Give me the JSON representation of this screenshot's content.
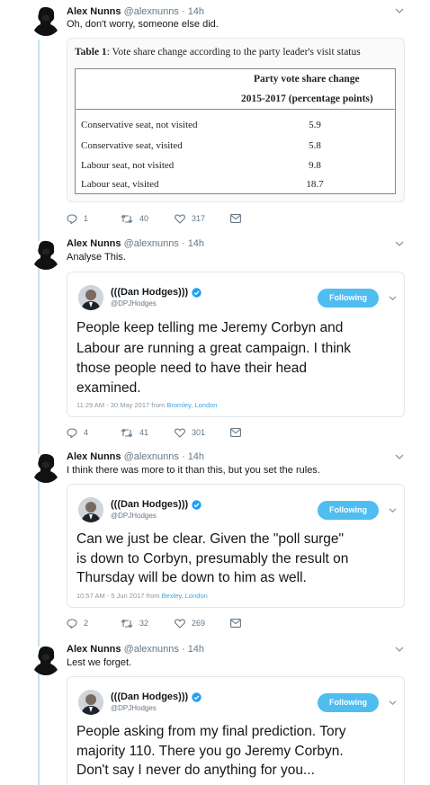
{
  "colors": {
    "accent": "#1da1f2",
    "follow_button": "#4fbdf0",
    "thread_line": "#c4e0f2",
    "text_muted": "#657786"
  },
  "tweets": [
    {
      "name": "Alex Nunns",
      "handle": "@alexnunns",
      "time": "· 14h",
      "text": "Oh, don't worry, someone else did.",
      "table": {
        "title_bold": "Table 1",
        "title_rest": ": Vote share change according to the party leader's visit status",
        "header1": "Party vote share change",
        "header2": "2015-2017 (percentage points)",
        "rows": [
          {
            "label": "Conservative seat, not visited",
            "value": "5.9"
          },
          {
            "label": "Conservative seat, visited",
            "value": "5.8"
          },
          {
            "label": "Labour seat, not visited",
            "value": "9.8"
          },
          {
            "label": "Labour seat, visited",
            "value": "18.7"
          }
        ]
      },
      "actions": {
        "replies": "1",
        "retweets": "40",
        "likes": "317"
      }
    },
    {
      "name": "Alex Nunns",
      "handle": "@alexnunns",
      "time": "· 14h",
      "text": "Analyse This.",
      "quote": {
        "name": "(((Dan Hodges)))",
        "handle": "@DPJHodges",
        "follow_label": "Following",
        "lines": [
          "People keep telling me Jeremy Corbyn and",
          "Labour are running a great campaign. I think",
          "those people need to have their head",
          "examined."
        ],
        "meta": "11:29 AM - 30 May 2017 from ",
        "location": "Bromley, London"
      },
      "actions": {
        "replies": "4",
        "retweets": "41",
        "likes": "301"
      }
    },
    {
      "name": "Alex Nunns",
      "handle": "@alexnunns",
      "time": "· 14h",
      "text": "I think there was more to it than this, but you set the rules.",
      "quote": {
        "name": "(((Dan Hodges)))",
        "handle": "@DPJHodges",
        "follow_label": "Following",
        "lines": [
          "Can we just be clear. Given the \"poll surge\"",
          "is down to Corbyn, presumably the result on",
          "Thursday will be down to him as well."
        ],
        "meta": "10:57 AM - 5 Jun 2017 from ",
        "location": "Bexley, London"
      },
      "actions": {
        "replies": "2",
        "retweets": "32",
        "likes": "269"
      }
    },
    {
      "name": "Alex Nunns",
      "handle": "@alexnunns",
      "time": "· 14h",
      "text": "Lest we forget.",
      "quote": {
        "name": "(((Dan Hodges)))",
        "handle": "@DPJHodges",
        "follow_label": "Following",
        "lines": [
          "People asking from my final prediction. Tory",
          "majority 110. There you go Jeremy Corbyn.",
          "Don't say I never do anything for you..."
        ]
      }
    }
  ]
}
